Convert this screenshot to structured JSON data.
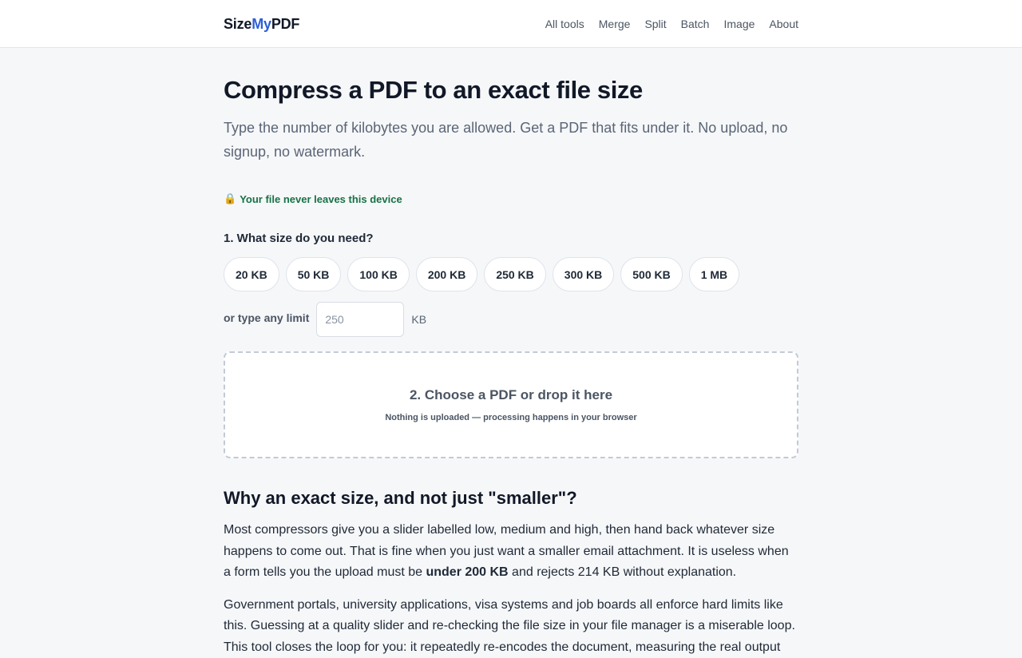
{
  "header": {
    "logo": {
      "part1": "Size",
      "part2": "My",
      "part3": "PDF"
    },
    "nav": [
      "All tools",
      "Merge",
      "Split",
      "Batch",
      "Image",
      "About"
    ],
    "accent_color": "#2b5fd9"
  },
  "hero": {
    "title": "Compress a PDF to an exact file size",
    "subtitle": "Type the number of kilobytes you are allowed. Get a PDF that fits under it. No upload, no signup, no watermark.",
    "trust_icon": "lock-icon",
    "trust_text": "Your file never leaves this device",
    "trust_color": "#177245"
  },
  "size_picker": {
    "heading": "1. What size do you need?",
    "presets": [
      "20 KB",
      "50 KB",
      "100 KB",
      "200 KB",
      "250 KB",
      "300 KB",
      "500 KB",
      "1 MB"
    ],
    "custom_label": "or type any limit",
    "custom_placeholder": "250",
    "custom_value": "",
    "unit": "KB"
  },
  "dropzone": {
    "title": "2. Choose a PDF or drop it here",
    "note": "Nothing is uploaded — processing happens in your browser"
  },
  "article": {
    "heading": "Why an exact size, and not just \"smaller\"?",
    "p1_before": "Most compressors give you a slider labelled low, medium and high, then hand back whatever size happens to come out. That is fine when you just want a smaller email attachment. It is useless when a form tells you the upload must be ",
    "p1_bold": "under 200 KB",
    "p1_after": " and rejects 214 KB without explanation.",
    "p2": "Government portals, university applications, visa systems and job boards all enforce hard limits like this. Guessing at a quality slider and re-checking the file size in your file manager is a miserable loop. This tool closes the loop for you: it repeatedly re-encodes the document, measuring the real output"
  }
}
